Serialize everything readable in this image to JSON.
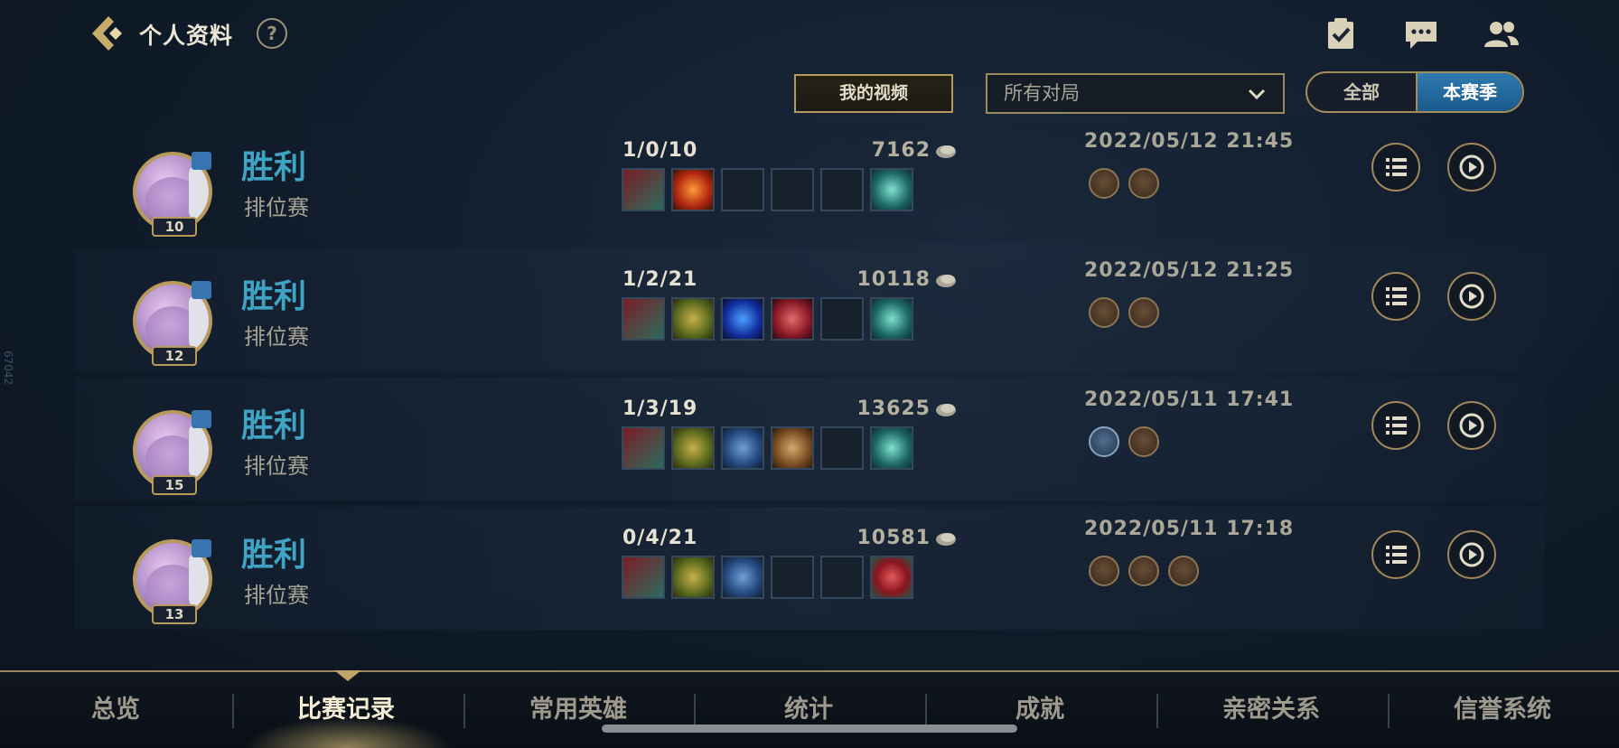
{
  "header": {
    "title": "个人资料",
    "help_label": "?"
  },
  "icons": {
    "back": "back-chevron-icon",
    "help": "help-icon",
    "tasks": "clipboard-check-icon",
    "chat": "chat-bubble-icon",
    "friends": "friends-icon",
    "coin": "gold-coin-icon"
  },
  "filters": {
    "video_label": "我的视频",
    "mode_selected": "所有对局",
    "season_options": [
      "全部",
      "本赛季"
    ],
    "season_selected": "本赛季"
  },
  "side_text": "67042",
  "matches": [
    {
      "result": "胜利",
      "queue": "排位赛",
      "level": "10",
      "kda": "1/0/10",
      "gold": "7162",
      "date": "2022/05/12 21:45",
      "items": [
        "thornmail",
        "fire-orb",
        "empty",
        "empty",
        "empty",
        "warding-totem"
      ],
      "medals": [
        "medal-bronze",
        "medal-bronze"
      ]
    },
    {
      "result": "胜利",
      "queue": "排位赛",
      "level": "12",
      "kda": "1/2/21",
      "gold": "10118",
      "date": "2022/05/12 21:25",
      "items": [
        "thornmail",
        "golden-plate",
        "blue-orb",
        "red-crystal",
        "empty",
        "warding-totem"
      ],
      "medals": [
        "medal-bronze",
        "medal-bronze"
      ]
    },
    {
      "result": "胜利",
      "queue": "排位赛",
      "level": "15",
      "kda": "1/3/19",
      "gold": "13625",
      "date": "2022/05/11 17:41",
      "items": [
        "thornmail",
        "golden-plate",
        "blue-armor",
        "bronze-armor",
        "empty",
        "warding-totem"
      ],
      "medals": [
        "medal-blue-flag",
        "medal-bronze"
      ]
    },
    {
      "result": "胜利",
      "queue": "排位赛",
      "level": "13",
      "kda": "0/4/21",
      "gold": "10581",
      "date": "2022/05/11 17:18",
      "items": [
        "thornmail",
        "golden-plate",
        "blue-armor",
        "empty",
        "empty",
        "red-boots"
      ],
      "medals": [
        "medal-bronze",
        "medal-bronze",
        "medal-bronze"
      ]
    }
  ],
  "bottom_nav": {
    "tabs": [
      "总览",
      "比赛记录",
      "常用英雄",
      "统计",
      "成就",
      "亲密关系",
      "信誉系统"
    ],
    "active": "比赛记录"
  },
  "colors": {
    "accent_gold": "#b39a5d",
    "win_blue": "#3fa3c4",
    "season_active": "#2e7ab0"
  }
}
